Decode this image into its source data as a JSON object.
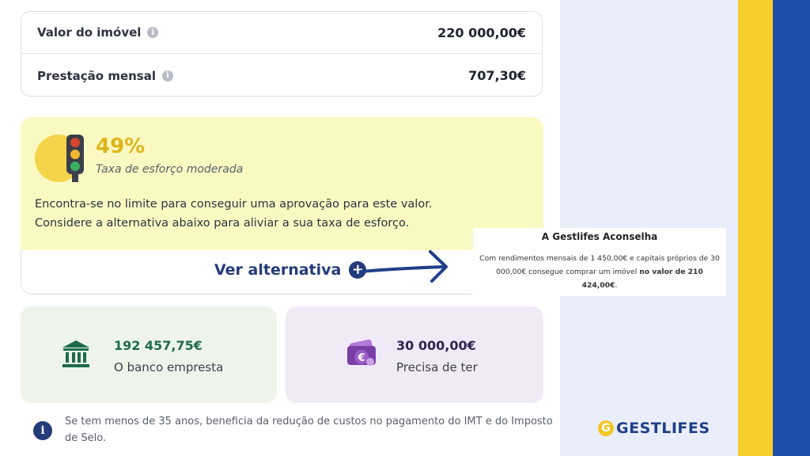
{
  "summary": {
    "property_value_label": "Valor do imóvel",
    "property_value": "220 000,00€",
    "monthly_payment_label": "Prestação mensal",
    "monthly_payment": "707,30€"
  },
  "effort": {
    "percent": "49%",
    "label": "Taxa de esforço moderada",
    "message_line1": "Encontra-se no limite para conseguir uma aprovação para este valor.",
    "message_line2": "Considere a alternativa abaixo para aliviar a sua taxa de esforço."
  },
  "alternative": {
    "button_label": "Ver alternativa",
    "plus_symbol": "+"
  },
  "cards": {
    "bank_amount": "192 457,75€",
    "bank_label": "O banco empresta",
    "own_amount": "30 000,00€",
    "own_label": "Precisa de ter"
  },
  "note": {
    "info_symbol": "i",
    "text": "Se tem menos de 35 anos, beneficia da redução de custos no pagamento do IMT e do Imposto de Selo."
  },
  "advice": {
    "title": "A Gestlifes Aconselha",
    "body_prefix": "Com rendimentos mensais de 1 450,00€ e capitais próprios de 30 000,00€ consegue comprar um imóvel ",
    "body_bold": "no valor de 210 424,00€",
    "body_suffix": "."
  },
  "brand": {
    "logo_letter": "G",
    "wordmark": "GESTLIFES"
  },
  "colors": {
    "effort_bg": "#fbf9c2",
    "accent_yellow": "#f6cf2e",
    "accent_blue": "#1f4ea8",
    "navy": "#243b7a",
    "bank_green": "#1e6b4a",
    "own_purple": "#7a3ea8"
  },
  "icons": [
    "info-icon",
    "traffic-light-icon",
    "plus-circle-icon",
    "bank-icon",
    "money-wallet-icon",
    "arrow-icon"
  ]
}
